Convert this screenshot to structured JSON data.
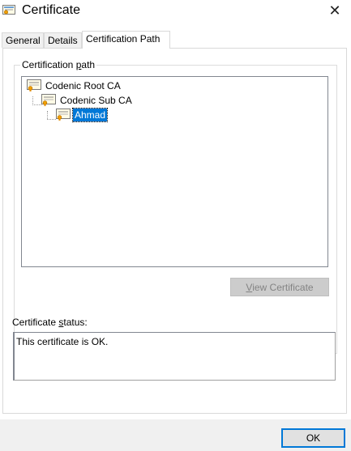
{
  "window": {
    "title": "Certificate",
    "close_glyph": "✕",
    "icon": "certificate-icon"
  },
  "tabs": [
    {
      "label": "General",
      "active": false
    },
    {
      "label": "Details",
      "active": false
    },
    {
      "label": "Certification Path",
      "active": true
    }
  ],
  "certification_path": {
    "group_label_pre": "Certification ",
    "group_label_access": "p",
    "group_label_post": "ath",
    "nodes": [
      {
        "label": "Codenic Root CA",
        "level": 0,
        "selected": false
      },
      {
        "label": "Codenic Sub CA",
        "level": 1,
        "selected": false
      },
      {
        "label": "Ahmad",
        "level": 2,
        "selected": true
      }
    ],
    "view_button_access": "V",
    "view_button_rest": "iew Certificate",
    "view_button_enabled": false
  },
  "status": {
    "label_pre": "Certificate ",
    "label_access": "s",
    "label_post": "tatus:",
    "text": "This certificate is OK."
  },
  "footer": {
    "ok_label": "OK"
  },
  "colors": {
    "selection": "#0078d7",
    "cert_ribbon": "#f0a000"
  }
}
